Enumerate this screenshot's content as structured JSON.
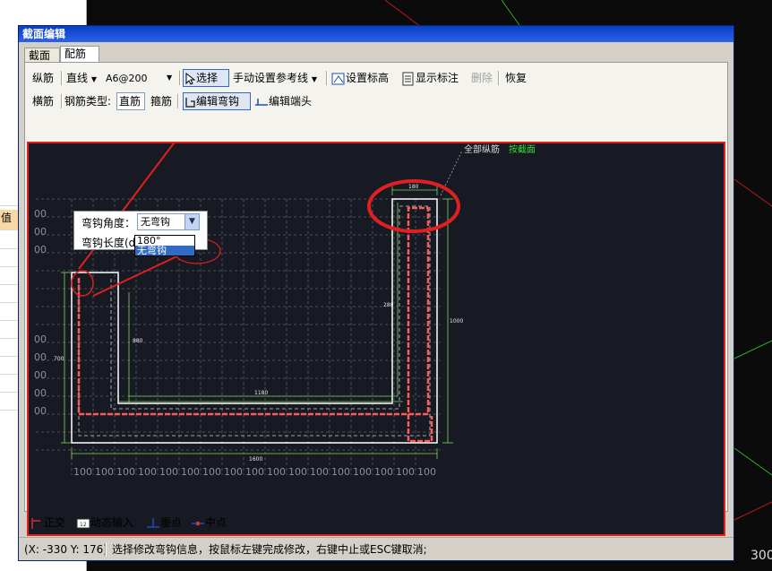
{
  "window": {
    "title": "截面编辑"
  },
  "tabs": [
    {
      "label": "截面"
    },
    {
      "label": "配筋"
    }
  ],
  "toolbar1": {
    "rebar_type_label": "纵筋",
    "line_combo": "直线",
    "spec_combo": "A6@200",
    "select_label": "选择",
    "manual_ref_label": "手动设置参考线",
    "set_elev_label": "设置标高",
    "show_dim_label": "显示标注",
    "delete_label": "删除",
    "restore_label": "恢复"
  },
  "toolbar2": {
    "hbar_label": "横筋",
    "bar_type_label": "钢筋类型:",
    "straight_label": "直筋",
    "stirrup_label": "箍筋",
    "edit_hook_label": "编辑弯钩",
    "edit_end_label": "编辑端头"
  },
  "canvas": {
    "note_white": "全部纵筋",
    "note_green": "按截面",
    "dims": {
      "d180": "180",
      "d280": "280",
      "d1000": "1000",
      "d700": "700",
      "d880": "880",
      "d1180": "1180",
      "d1600": "1600"
    },
    "grid_labels": {
      "left": "00",
      "bottom": "100"
    }
  },
  "hook_popup": {
    "angle_label": "弯钩角度：",
    "angle_value": "无弯钩",
    "length_label": "弯钩长度(d)",
    "options": [
      "180°",
      "无弯钩"
    ],
    "selected": "无弯钩"
  },
  "bottombar": {
    "ortho": "正交",
    "dyn_input": "动态输入",
    "perp": "垂点",
    "mid": "中点"
  },
  "statusbar": {
    "coords": "(X: -330 Y: 176)",
    "message": "选择修改弯钩信息，按鼠标左键完成修改，右键中止或ESC键取消;"
  },
  "left_panel": {
    "highlight_label": "值"
  },
  "corner_text": "300",
  "colors": {
    "accent_red": "#e02020",
    "green": "#7ed957",
    "canvas_bg": "#171a22",
    "title_blue": "#0a3ec4"
  }
}
